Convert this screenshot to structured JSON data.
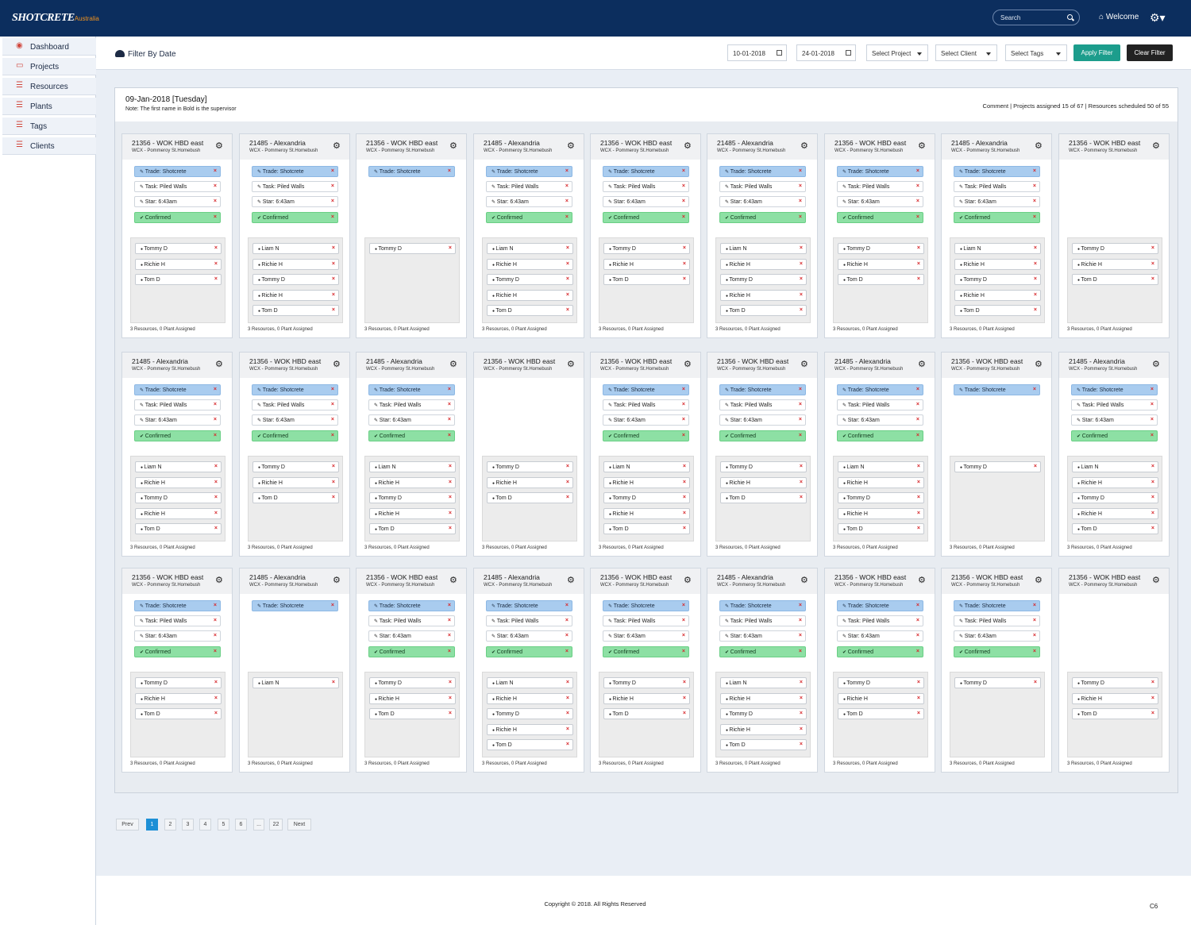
{
  "header": {
    "logo": "SHOTCRETE",
    "logo_suffix": "Australia",
    "search_placeholder": "Search",
    "welcome": "Welcome"
  },
  "sidebar": {
    "items": [
      {
        "label": "Dashboard",
        "icon": "dashboard-icon"
      },
      {
        "label": "Projects",
        "icon": "monitor-icon"
      },
      {
        "label": "Resources",
        "icon": "list-icon"
      },
      {
        "label": "Plants",
        "icon": "list-icon"
      },
      {
        "label": "Tags",
        "icon": "list-icon"
      },
      {
        "label": "Clients",
        "icon": "list-icon"
      }
    ]
  },
  "filter": {
    "title": "Filter By Date",
    "date_from": "10-01-2018",
    "date_to": "24-01-2018",
    "select_project": "Select Project",
    "select_client": "Select Client",
    "select_tags": "Select Tags",
    "apply": "Apply Filter",
    "clear": "Clear Filter"
  },
  "panel": {
    "date": "09-Jan-2018 [Tuesday]",
    "note": "Note: The first name in Bold is the supervisor",
    "summary": "Comment  |  Projects assigned 15 of 67  |  Resources scheduled 50 of 55"
  },
  "labels": {
    "trade": "Trade: Shotcrete",
    "task": "Task: Piled Walls",
    "star": "Star: 6:43am",
    "confirmed": "Confirmed",
    "footer": "3 Resources, 0 Plant Assigned",
    "close": "×"
  },
  "cards": [
    {
      "title": "21356 - WOK HBD east",
      "sub": "WCX - Pommeroy St.Homebush",
      "full": true,
      "res": [
        "Tommy D",
        "Richie H",
        "Tom D"
      ]
    },
    {
      "title": "21485 - Alexandria",
      "sub": "WCX - Pommeroy St.Homebush",
      "full": true,
      "res": [
        "Liam N",
        "Richie H",
        "Tommy D",
        "Richie H",
        "Tom D"
      ]
    },
    {
      "title": "21356 - WOK HBD east",
      "sub": "WCX - Pommeroy St.Homebush",
      "full": false,
      "res": [
        "Tommy D"
      ]
    },
    {
      "title": "21485 - Alexandria",
      "sub": "WCX - Pommeroy St.Homebush",
      "full": true,
      "res": [
        "Liam N",
        "Richie H",
        "Tommy D",
        "Richie H",
        "Tom D"
      ]
    },
    {
      "title": "21356 - WOK HBD east",
      "sub": "WCX - Pommeroy St.Homebush",
      "full": true,
      "res": [
        "Tommy D",
        "Richie H",
        "Tom D"
      ]
    },
    {
      "title": "21485 - Alexandria",
      "sub": "WCX - Pommeroy St.Homebush",
      "full": true,
      "res": [
        "Liam N",
        "Richie H",
        "Tommy D",
        "Richie H",
        "Tom D"
      ]
    },
    {
      "title": "21356 - WOK HBD east",
      "sub": "WCX - Pommeroy St.Homebush",
      "full": true,
      "res": [
        "Tommy D",
        "Richie H",
        "Tom D"
      ]
    },
    {
      "title": "21485 - Alexandria",
      "sub": "WCX - Pommeroy St.Homebush",
      "full": true,
      "res": [
        "Liam N",
        "Richie H",
        "Tommy D",
        "Richie H",
        "Tom D"
      ]
    },
    {
      "title": "21356 - WOK HBD east",
      "sub": "WCX - Pommeroy St.Homebush",
      "full": null,
      "res": [
        "Tommy D",
        "Richie H",
        "Tom D"
      ]
    },
    {
      "title": "21485 - Alexandria",
      "sub": "WCX - Pommeroy St.Homebush",
      "full": true,
      "res": [
        "Liam N",
        "Richie H",
        "Tommy D",
        "Richie H",
        "Tom D"
      ]
    },
    {
      "title": "21356 - WOK HBD east",
      "sub": "WCX - Pommeroy St.Homebush",
      "full": true,
      "res": [
        "Tommy D",
        "Richie H",
        "Tom D"
      ]
    },
    {
      "title": "21485 - Alexandria",
      "sub": "WCX - Pommeroy St.Homebush",
      "full": true,
      "res": [
        "Liam N",
        "Richie H",
        "Tommy D",
        "Richie H",
        "Tom D"
      ]
    },
    {
      "title": "21356 - WOK HBD east",
      "sub": "WCX - Pommeroy St.Homebush",
      "full": null,
      "res": [
        "Tommy D",
        "Richie H",
        "Tom D"
      ]
    },
    {
      "title": "21356 - WOK HBD east",
      "sub": "WCX - Pommeroy St.Homebush",
      "full": true,
      "res": [
        "Liam N",
        "Richie H",
        "Tommy D",
        "Richie H",
        "Tom D"
      ]
    },
    {
      "title": "21356 - WOK HBD east",
      "sub": "WCX - Pommeroy St.Homebush",
      "full": true,
      "res": [
        "Tommy D",
        "Richie H",
        "Tom D"
      ]
    },
    {
      "title": "21485 - Alexandria",
      "sub": "WCX - Pommeroy St.Homebush",
      "full": true,
      "res": [
        "Liam N",
        "Richie H",
        "Tommy D",
        "Richie H",
        "Tom D"
      ]
    },
    {
      "title": "21356 - WOK HBD east",
      "sub": "WCX - Pommeroy St.Homebush",
      "full": false,
      "res": [
        "Tommy D"
      ]
    },
    {
      "title": "21485 - Alexandria",
      "sub": "WCX - Pommeroy St.Homebush",
      "full": true,
      "res": [
        "Liam N",
        "Richie H",
        "Tommy D",
        "Richie H",
        "Tom D"
      ]
    },
    {
      "title": "21356 - WOK HBD east",
      "sub": "WCX - Pommeroy St.Homebush",
      "full": true,
      "res": [
        "Tommy D",
        "Richie H",
        "Tom D"
      ]
    },
    {
      "title": "21485 - Alexandria",
      "sub": "WCX - Pommeroy St.Homebush",
      "full": false,
      "res": [
        "Liam N"
      ]
    },
    {
      "title": "21356 - WOK HBD east",
      "sub": "WCX - Pommeroy St.Homebush",
      "full": true,
      "res": [
        "Tommy D",
        "Richie H",
        "Tom D"
      ]
    },
    {
      "title": "21485 - Alexandria",
      "sub": "WCX - Pommeroy St.Homebush",
      "full": true,
      "res": [
        "Liam N",
        "Richie H",
        "Tommy D",
        "Richie H",
        "Tom D"
      ]
    },
    {
      "title": "21356 - WOK HBD east",
      "sub": "WCX - Pommeroy St.Homebush",
      "full": true,
      "res": [
        "Tommy D",
        "Richie H",
        "Tom D"
      ]
    },
    {
      "title": "21485 - Alexandria",
      "sub": "WCX - Pommeroy St.Homebush",
      "full": true,
      "res": [
        "Liam N",
        "Richie H",
        "Tommy D",
        "Richie H",
        "Tom D"
      ]
    },
    {
      "title": "21356 - WOK HBD east",
      "sub": "WCX - Pommeroy St.Homebush",
      "full": true,
      "res": [
        "Tommy D",
        "Richie H",
        "Tom D"
      ]
    },
    {
      "title": "21356 - WOK HBD east",
      "sub": "WCX - Pommeroy St.Homebush",
      "full": true,
      "res": [
        "Tommy D"
      ]
    },
    {
      "title": "21356 - WOK HBD east",
      "sub": "WCX - Pommeroy St.Homebush",
      "full": null,
      "res": [
        "Tommy D",
        "Richie H",
        "Tom D"
      ]
    }
  ],
  "pagination": [
    "Prev",
    "1",
    "2",
    "3",
    "4",
    "5",
    "6",
    "...",
    "22",
    "Next"
  ],
  "pagination_active": "1",
  "footer": {
    "copyright": "Copyright © 2018. All Rights Reserved",
    "code": "C6"
  },
  "colors": {
    "topbar": "#0c2e5e",
    "trade_tag": "#a9ccef",
    "confirmed_tag": "#8de0a4",
    "apply_button": "#1c9d8c",
    "page_active": "#1d8fd6",
    "remove_x": "#d6282c"
  }
}
